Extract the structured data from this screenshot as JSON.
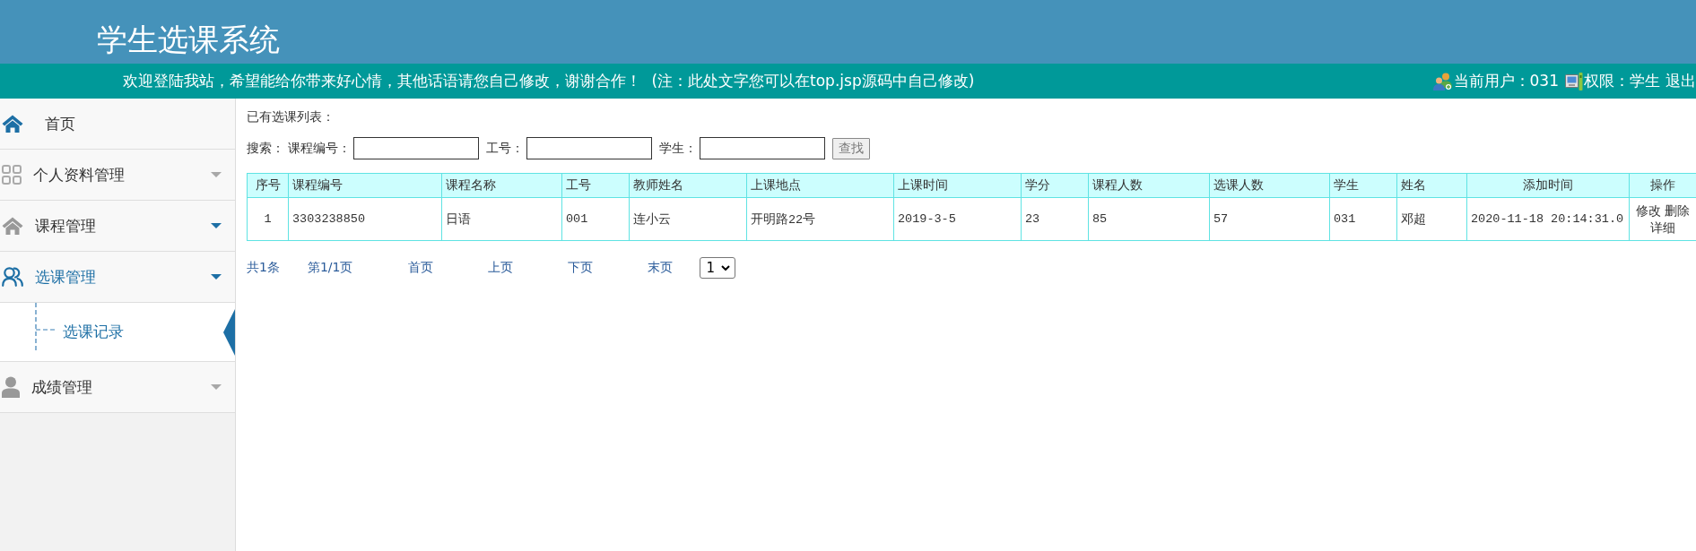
{
  "header": {
    "title": "学生选课系统"
  },
  "notice_bar": {
    "message": "欢迎登陆我站，希望能给你带来好心情，其他话语请您自己修改，谢谢合作！ (注：此处文字您可以在top.jsp源码中自己修改)",
    "current_user": "当前用户：031",
    "role": "权限：学生",
    "logout": "退出"
  },
  "sidebar": {
    "items": [
      {
        "kind": "link",
        "label": "首页",
        "selected": false
      },
      {
        "kind": "group",
        "label": "个人资料管理",
        "selected": false,
        "highlighted": false
      },
      {
        "kind": "group",
        "label": "课程管理",
        "selected": false,
        "highlighted": true
      },
      {
        "kind": "group",
        "label": "选课管理",
        "selected": true,
        "highlighted": true,
        "children": [
          {
            "label": "选课记录",
            "selected": true
          }
        ]
      },
      {
        "kind": "group",
        "label": "成绩管理",
        "selected": false,
        "highlighted": false
      }
    ]
  },
  "content": {
    "heading": "已有选课列表：",
    "search": {
      "label": "搜索：",
      "fields": [
        {
          "label": "课程编号："
        },
        {
          "label": "工号："
        },
        {
          "label": "学生："
        }
      ],
      "button": "查找"
    },
    "table": {
      "columns": [
        "序号",
        "课程编号",
        "课程名称",
        "工号",
        "教师姓名",
        "上课地点",
        "上课时间",
        "学分",
        "课程人数",
        "选课人数",
        "学生",
        "姓名",
        "添加时间",
        "操作"
      ],
      "rows": [
        {
          "cells": [
            "1",
            "3303238850",
            "日语",
            "001",
            "连小云",
            "开明路22号",
            "2019-3-5",
            "23",
            "85",
            "57",
            "031",
            "邓超",
            "2020-11-18 20:14:31.0"
          ],
          "actions": [
            "修改",
            "删除",
            "详细"
          ]
        }
      ]
    },
    "pagination": {
      "total": "共1条",
      "page": "第1/1页",
      "links": [
        "首页",
        "上页",
        "下页",
        "末页"
      ],
      "page_select": "1"
    }
  }
}
